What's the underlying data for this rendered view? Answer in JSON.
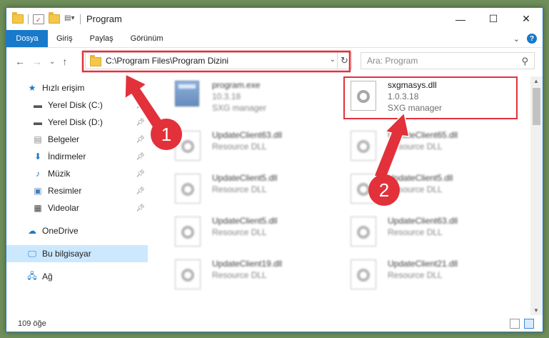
{
  "window": {
    "title": "Program",
    "controls": {
      "minimize": "—",
      "maximize": "☐",
      "close": "✕"
    }
  },
  "ribbon": {
    "tabs": [
      "Dosya",
      "Giriş",
      "Paylaş",
      "Görünüm"
    ],
    "expand": "⌄",
    "help": "?"
  },
  "navigation": {
    "back": "←",
    "forward": "→",
    "recent": "⌄",
    "up": "↑"
  },
  "address": {
    "path": "C:\\Program Files\\Program Dizini",
    "dropdown": "⌄",
    "refresh": "↻"
  },
  "search": {
    "placeholder": "Ara: Program",
    "icon": "⚲"
  },
  "sidebar": {
    "quick_access": "Hızlı erişim",
    "items": [
      {
        "label": "Yerel Disk (C:)",
        "icon": "drive-icon"
      },
      {
        "label": "Yerel Disk (D:)",
        "icon": "drive-icon"
      },
      {
        "label": "Belgeler",
        "icon": "documents-icon"
      },
      {
        "label": "İndirmeler",
        "icon": "downloads-icon"
      },
      {
        "label": "Müzik",
        "icon": "music-icon"
      },
      {
        "label": "Resimler",
        "icon": "pictures-icon"
      },
      {
        "label": "Videolar",
        "icon": "videos-icon"
      }
    ],
    "onedrive": "OneDrive",
    "this_pc": "Bu bilgisayar",
    "network": "Ağ"
  },
  "files": [
    {
      "name": "program.exe",
      "line2": "10.3.18",
      "line3": "SXG manager",
      "blurred": true,
      "type": "exe"
    },
    {
      "name": "sxgmasys.dll",
      "line2": "1.0.3.18",
      "line3": "SXG manager",
      "blurred": false,
      "type": "dll"
    },
    {
      "name": "UpdateClient63.dll",
      "line2": "Resource DLL",
      "blurred": true,
      "type": "dll"
    },
    {
      "name": "UpdateClient65.dll",
      "line2": "Resource DLL",
      "blurred": true,
      "type": "dll"
    },
    {
      "name": "UpdateClient5.dll",
      "line2": "Resource DLL",
      "blurred": true,
      "type": "dll"
    },
    {
      "name": "UpdateClient5.dll",
      "line2": "Resource DLL",
      "blurred": true,
      "type": "dll"
    },
    {
      "name": "UpdateClient5.dll",
      "line2": "Resource DLL",
      "blurred": true,
      "type": "dll"
    },
    {
      "name": "UpdateClient63.dll",
      "line2": "Resource DLL",
      "blurred": true,
      "type": "dll"
    },
    {
      "name": "UpdateClient19.dll",
      "line2": "Resource DLL",
      "blurred": true,
      "type": "dll"
    },
    {
      "name": "UpdateClient21.dll",
      "line2": "Resource DLL",
      "blurred": true,
      "type": "dll"
    }
  ],
  "status": {
    "count": "109 öğe"
  },
  "annotations": {
    "badge1": "1",
    "badge2": "2",
    "color": "#e2313a"
  }
}
